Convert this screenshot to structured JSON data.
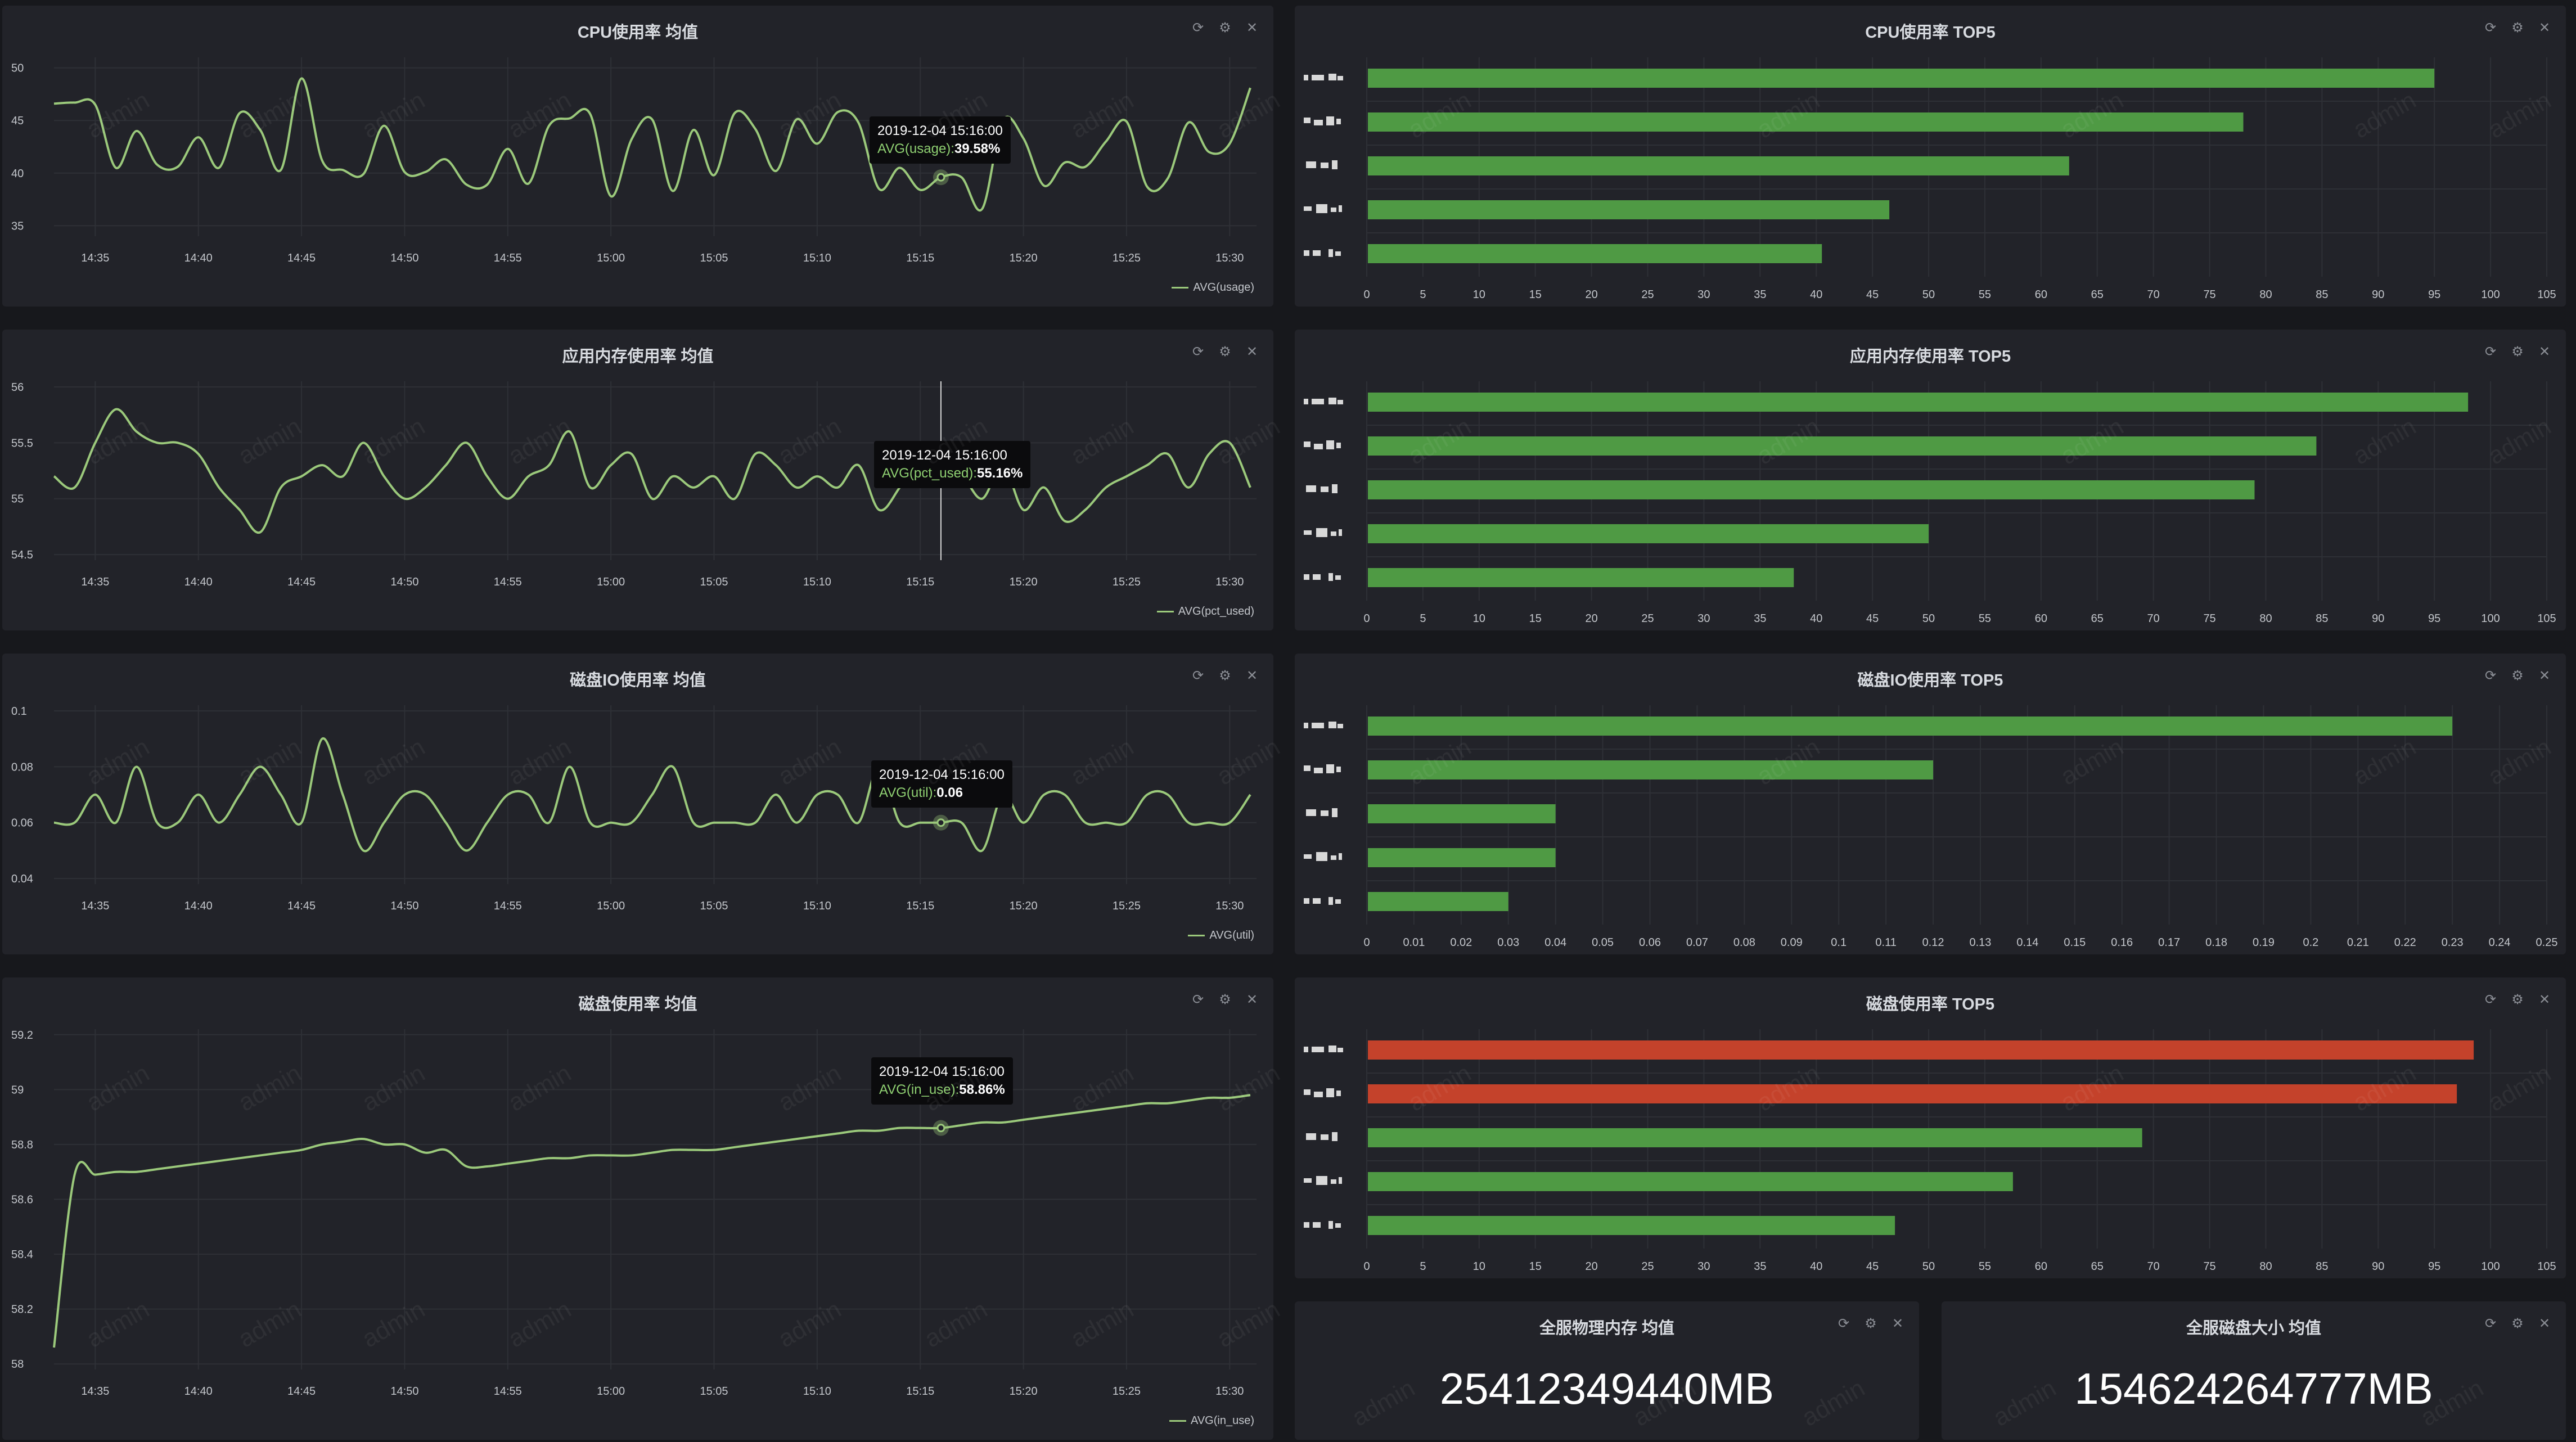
{
  "watermark": "admin",
  "colors": {
    "line": "#9bc97b",
    "bar_ok": "#4f9a44",
    "bar_alert": "#c4422b"
  },
  "controls": {
    "refresh": "refresh-icon",
    "settings": "gear-icon",
    "close": "close-icon"
  },
  "line_panels": [
    {
      "title": "CPU使用率 均值",
      "tooltip": {
        "time": "2019-12-04 15:16:00",
        "key": "AVG(usage):",
        "value": "39.58%"
      },
      "legend": "AVG(usage)",
      "chart_data": {
        "type": "line",
        "x": [
          "14:33",
          "14:34",
          "14:35",
          "14:36",
          "14:37",
          "14:38",
          "14:39",
          "14:40",
          "14:41",
          "14:42",
          "14:43",
          "14:44",
          "14:45",
          "14:46",
          "14:47",
          "14:48",
          "14:49",
          "14:50",
          "14:51",
          "14:52",
          "14:53",
          "14:54",
          "14:55",
          "14:56",
          "14:57",
          "14:58",
          "14:59",
          "15:00",
          "15:01",
          "15:02",
          "15:03",
          "15:04",
          "15:05",
          "15:06",
          "15:07",
          "15:08",
          "15:09",
          "15:10",
          "15:11",
          "15:12",
          "15:13",
          "15:14",
          "15:15",
          "15:16",
          "15:17",
          "15:18",
          "15:19",
          "15:20",
          "15:21",
          "15:22",
          "15:23",
          "15:24",
          "15:25",
          "15:26",
          "15:27",
          "15:28",
          "15:29",
          "15:30",
          "15:31"
        ],
        "series": [
          {
            "name": "AVG(usage)",
            "values": [
              46.6,
              46.7,
              46.5,
              40.5,
              44.0,
              40.8,
              40.6,
              43.4,
              40.5,
              45.7,
              44.1,
              40.3,
              49.0,
              41.2,
              40.3,
              39.9,
              44.5,
              40.1,
              40.1,
              41.3,
              38.9,
              38.9,
              42.3,
              39.0,
              44.5,
              45.2,
              45.6,
              37.8,
              43.2,
              45.1,
              38.3,
              44.1,
              39.8,
              45.7,
              44.2,
              40.2,
              45.1,
              42.8,
              45.8,
              44.8,
              38.5,
              40.5,
              38.4,
              39.6,
              39.6,
              36.6,
              45.0,
              43.3,
              38.8,
              41.0,
              40.6,
              43.0,
              44.9,
              38.7,
              39.5,
              44.8,
              42.0,
              42.8,
              48.1
            ]
          }
        ],
        "y_ticks": [
          35,
          40,
          45,
          50
        ],
        "ylim": [
          34,
          51
        ],
        "x_ticks": [
          "14:35",
          "14:40",
          "14:45",
          "14:50",
          "14:55",
          "15:00",
          "15:05",
          "15:10",
          "15:15",
          "15:20",
          "15:25",
          "15:30"
        ]
      }
    },
    {
      "title": "应用内存使用率 均值",
      "tooltip": {
        "time": "2019-12-04 15:16:00",
        "key": "AVG(pct_used):",
        "value": "55.16%"
      },
      "legend": "AVG(pct_used)",
      "chart_data": {
        "type": "line",
        "x": [
          "14:33",
          "14:34",
          "14:35",
          "14:36",
          "14:37",
          "14:38",
          "14:39",
          "14:40",
          "14:41",
          "14:42",
          "14:43",
          "14:44",
          "14:45",
          "14:46",
          "14:47",
          "14:48",
          "14:49",
          "14:50",
          "14:51",
          "14:52",
          "14:53",
          "14:54",
          "14:55",
          "14:56",
          "14:57",
          "14:58",
          "14:59",
          "15:00",
          "15:01",
          "15:02",
          "15:03",
          "15:04",
          "15:05",
          "15:06",
          "15:07",
          "15:08",
          "15:09",
          "15:10",
          "15:11",
          "15:12",
          "15:13",
          "15:14",
          "15:15",
          "15:16",
          "15:17",
          "15:18",
          "15:19",
          "15:20",
          "15:21",
          "15:22",
          "15:23",
          "15:24",
          "15:25",
          "15:26",
          "15:27",
          "15:28",
          "15:29",
          "15:30",
          "15:31"
        ],
        "series": [
          {
            "name": "AVG(pct_used)",
            "values": [
              55.2,
              55.1,
              55.5,
              55.8,
              55.6,
              55.5,
              55.5,
              55.4,
              55.1,
              54.9,
              54.7,
              55.1,
              55.2,
              55.3,
              55.2,
              55.5,
              55.2,
              55.0,
              55.1,
              55.3,
              55.5,
              55.2,
              55.0,
              55.2,
              55.3,
              55.6,
              55.1,
              55.3,
              55.4,
              55.0,
              55.2,
              55.1,
              55.2,
              55.0,
              55.4,
              55.3,
              55.1,
              55.2,
              55.1,
              55.3,
              54.9,
              55.1,
              55.4,
              55.16,
              55.2,
              55.0,
              55.3,
              54.9,
              55.1,
              54.8,
              54.9,
              55.1,
              55.2,
              55.3,
              55.4,
              55.1,
              55.4,
              55.5,
              55.1
            ]
          }
        ],
        "y_ticks": [
          54.5,
          55,
          55.5,
          56
        ],
        "ylim": [
          54.45,
          56.05
        ],
        "x_ticks": [
          "14:35",
          "14:40",
          "14:45",
          "14:50",
          "14:55",
          "15:00",
          "15:05",
          "15:10",
          "15:15",
          "15:20",
          "15:25",
          "15:30"
        ]
      }
    },
    {
      "title": "磁盘IO使用率 均值",
      "tooltip": {
        "time": "2019-12-04 15:16:00",
        "key": "AVG(util):",
        "value": "0.06"
      },
      "legend": "AVG(util)",
      "chart_data": {
        "type": "line",
        "x": [
          "14:33",
          "14:34",
          "14:35",
          "14:36",
          "14:37",
          "14:38",
          "14:39",
          "14:40",
          "14:41",
          "14:42",
          "14:43",
          "14:44",
          "14:45",
          "14:46",
          "14:47",
          "14:48",
          "14:49",
          "14:50",
          "14:51",
          "14:52",
          "14:53",
          "14:54",
          "14:55",
          "14:56",
          "14:57",
          "14:58",
          "14:59",
          "15:00",
          "15:01",
          "15:02",
          "15:03",
          "15:04",
          "15:05",
          "15:06",
          "15:07",
          "15:08",
          "15:09",
          "15:10",
          "15:11",
          "15:12",
          "15:13",
          "15:14",
          "15:15",
          "15:16",
          "15:17",
          "15:18",
          "15:19",
          "15:20",
          "15:21",
          "15:22",
          "15:23",
          "15:24",
          "15:25",
          "15:26",
          "15:27",
          "15:28",
          "15:29",
          "15:30",
          "15:31"
        ],
        "series": [
          {
            "name": "AVG(util)",
            "values": [
              0.06,
              0.06,
              0.07,
              0.06,
              0.08,
              0.06,
              0.06,
              0.07,
              0.06,
              0.07,
              0.08,
              0.07,
              0.06,
              0.09,
              0.07,
              0.05,
              0.06,
              0.07,
              0.07,
              0.06,
              0.05,
              0.06,
              0.07,
              0.07,
              0.06,
              0.08,
              0.06,
              0.06,
              0.06,
              0.07,
              0.08,
              0.06,
              0.06,
              0.06,
              0.06,
              0.07,
              0.06,
              0.07,
              0.07,
              0.06,
              0.08,
              0.06,
              0.06,
              0.06,
              0.06,
              0.05,
              0.07,
              0.06,
              0.07,
              0.07,
              0.06,
              0.06,
              0.06,
              0.07,
              0.07,
              0.06,
              0.06,
              0.06,
              0.07
            ]
          }
        ],
        "y_ticks": [
          0.04,
          0.06,
          0.08,
          0.1
        ],
        "ylim": [
          0.038,
          0.102
        ],
        "x_ticks": [
          "14:35",
          "14:40",
          "14:45",
          "14:50",
          "14:55",
          "15:00",
          "15:05",
          "15:10",
          "15:15",
          "15:20",
          "15:25",
          "15:30"
        ]
      }
    },
    {
      "title": "磁盘使用率 均值",
      "tooltip": {
        "time": "2019-12-04 15:16:00",
        "key": "AVG(in_use):",
        "value": "58.86%"
      },
      "legend": "AVG(in_use)",
      "chart_data": {
        "type": "line",
        "x": [
          "14:33",
          "14:34",
          "14:35",
          "14:36",
          "14:37",
          "14:38",
          "14:39",
          "14:40",
          "14:41",
          "14:42",
          "14:43",
          "14:44",
          "14:45",
          "14:46",
          "14:47",
          "14:48",
          "14:49",
          "14:50",
          "14:51",
          "14:52",
          "14:53",
          "14:54",
          "14:55",
          "14:56",
          "14:57",
          "14:58",
          "14:59",
          "15:00",
          "15:01",
          "15:02",
          "15:03",
          "15:04",
          "15:05",
          "15:06",
          "15:07",
          "15:08",
          "15:09",
          "15:10",
          "15:11",
          "15:12",
          "15:13",
          "15:14",
          "15:15",
          "15:16",
          "15:17",
          "15:18",
          "15:19",
          "15:20",
          "15:21",
          "15:22",
          "15:23",
          "15:24",
          "15:25",
          "15:26",
          "15:27",
          "15:28",
          "15:29",
          "15:30",
          "15:31"
        ],
        "series": [
          {
            "name": "AVG(in_use)",
            "values": [
              58.06,
              58.69,
              58.69,
              58.7,
              58.7,
              58.71,
              58.72,
              58.73,
              58.74,
              58.75,
              58.76,
              58.77,
              58.78,
              58.8,
              58.81,
              58.82,
              58.8,
              58.8,
              58.77,
              58.78,
              58.72,
              58.72,
              58.73,
              58.74,
              58.75,
              58.75,
              58.76,
              58.76,
              58.76,
              58.77,
              58.78,
              58.78,
              58.78,
              58.79,
              58.8,
              58.81,
              58.82,
              58.83,
              58.84,
              58.85,
              58.85,
              58.86,
              58.86,
              58.86,
              58.87,
              58.88,
              58.88,
              58.89,
              58.9,
              58.91,
              58.92,
              58.93,
              58.94,
              58.95,
              58.95,
              58.96,
              58.97,
              58.97,
              58.98
            ]
          }
        ],
        "y_ticks": [
          58,
          58.2,
          58.4,
          58.6,
          58.8,
          59,
          59.2
        ],
        "ylim": [
          57.98,
          59.22
        ],
        "x_ticks": [
          "14:35",
          "14:40",
          "14:45",
          "14:50",
          "14:55",
          "15:00",
          "15:05",
          "15:10",
          "15:15",
          "15:20",
          "15:25",
          "15:30"
        ]
      }
    }
  ],
  "bar_panels": [
    {
      "title": "CPU使用率 TOP5",
      "chart_data": {
        "type": "bar",
        "orientation": "horizontal",
        "values": [
          95,
          78,
          62.5,
          46.5,
          40.5
        ],
        "alert": [
          false,
          false,
          false,
          false,
          false
        ],
        "x_ticks": [
          0,
          5,
          10,
          15,
          20,
          25,
          30,
          35,
          40,
          45,
          50,
          55,
          60,
          65,
          70,
          75,
          80,
          85,
          90,
          95,
          100,
          105
        ],
        "xlim": [
          0,
          105
        ]
      }
    },
    {
      "title": "应用内存使用率 TOP5",
      "chart_data": {
        "type": "bar",
        "orientation": "horizontal",
        "values": [
          98,
          84.5,
          79,
          50,
          38
        ],
        "alert": [
          false,
          false,
          false,
          false,
          false
        ],
        "x_ticks": [
          0,
          5,
          10,
          15,
          20,
          25,
          30,
          35,
          40,
          45,
          50,
          55,
          60,
          65,
          70,
          75,
          80,
          85,
          90,
          95,
          100,
          105
        ],
        "xlim": [
          0,
          105
        ]
      }
    },
    {
      "title": "磁盘IO使用率 TOP5",
      "chart_data": {
        "type": "bar",
        "orientation": "horizontal",
        "values": [
          0.23,
          0.12,
          0.04,
          0.04,
          0.03
        ],
        "alert": [
          false,
          false,
          false,
          false,
          false
        ],
        "x_ticks": [
          "0",
          "0.01",
          "0.02",
          "0.03",
          "0.04",
          "0.05",
          "0.06",
          "0.07",
          "0.08",
          "0.09",
          "0.1",
          "0.11",
          "0.12",
          "0.13",
          "0.14",
          "0.15",
          "0.16",
          "0.17",
          "0.18",
          "0.19",
          "0.2",
          "0.21",
          "0.22",
          "0.23",
          "0.24",
          "0.25"
        ],
        "xlim": [
          0,
          0.25
        ]
      }
    },
    {
      "title": "磁盘使用率 TOP5",
      "chart_data": {
        "type": "bar",
        "orientation": "horizontal",
        "values": [
          98.5,
          97,
          69,
          57.5,
          47
        ],
        "alert": [
          true,
          true,
          false,
          false,
          false
        ],
        "x_ticks": [
          0,
          5,
          10,
          15,
          20,
          25,
          30,
          35,
          40,
          45,
          50,
          55,
          60,
          65,
          70,
          75,
          80,
          85,
          90,
          95,
          100,
          105
        ],
        "xlim": [
          0,
          105
        ]
      }
    }
  ],
  "stat_panels": [
    {
      "title": "全服物理内存 均值",
      "value": "25412349440MB"
    },
    {
      "title": "全服磁盘大小 均值",
      "value": "154624264777MB"
    }
  ]
}
